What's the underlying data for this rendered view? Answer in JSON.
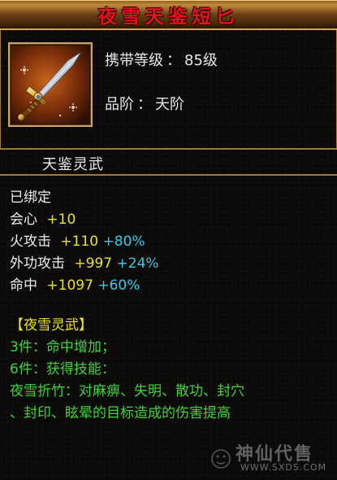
{
  "tooltip": {
    "title": "夜雪天鉴短匕",
    "item_icon": "dagger-icon",
    "carry_level_label": "携带等级",
    "carry_level_value": "85级",
    "grade_label": "品阶",
    "grade_value": "天阶",
    "separator": "：",
    "section_title": "天鉴灵武",
    "bound_status": "已绑定",
    "stats": [
      {
        "name": "会心",
        "base": "+10",
        "bonus": ""
      },
      {
        "name": "火攻击",
        "base": "+110",
        "bonus": "+80%"
      },
      {
        "name": "外功攻击",
        "base": "+997",
        "bonus": "+24%"
      },
      {
        "name": "命中",
        "base": "+1097",
        "bonus": "+60%"
      }
    ],
    "set_name": "【夜雪灵武】",
    "set_bonus_3": "3件：命中增加；",
    "set_bonus_6": "6件：获得技能：",
    "skill_line_1": "夜雪折竹：对麻痹、失明、散功、封穴",
    "skill_line_2": "、封印、眩晕的目标造成的伤害提高",
    "colors": {
      "title": "#e2141c",
      "white_text": "#ececec",
      "yellow_text": "#e9e22d",
      "cyan_text": "#39c8e6",
      "green_text": "#3fd23a",
      "border_gold": "#9c7a3a"
    }
  },
  "watermark": {
    "text": "神仙代售",
    "url": "WWW.SXDS.COM"
  }
}
